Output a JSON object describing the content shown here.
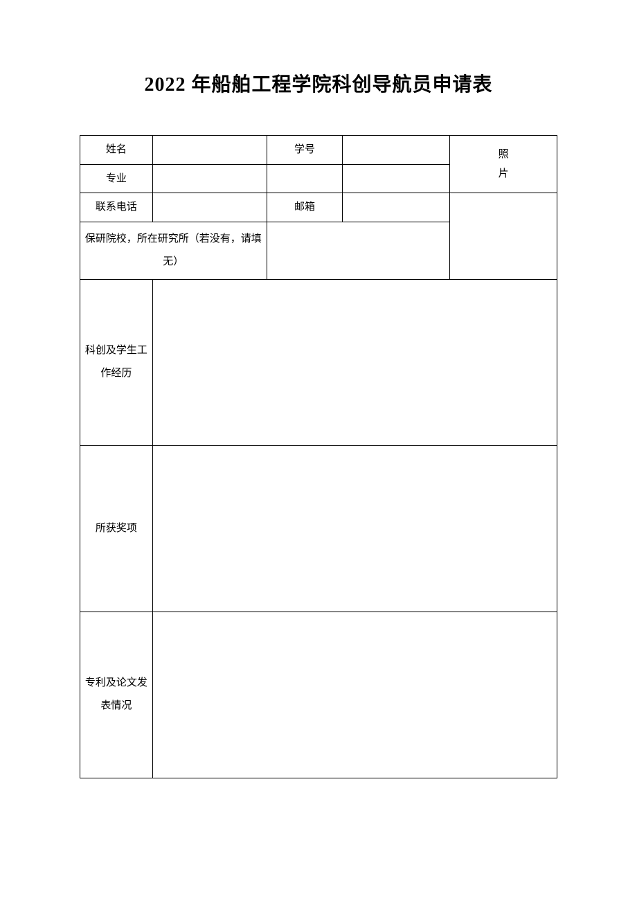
{
  "title": "2022 年船舶工程学院科创导航员申请表",
  "labels": {
    "name": "姓名",
    "student_id": "学号",
    "photo_line1": "照",
    "photo_line2": "片",
    "major": "专业",
    "phone": "联系电话",
    "email": "邮箱",
    "grad_school": "保研院校，所在研究所（若没有，请填无）",
    "experience": "科创及学生工作经历",
    "awards": "所获奖项",
    "patents": "专利及论文发表情况"
  },
  "values": {
    "name": "",
    "student_id": "",
    "major": "",
    "major_extra1": "",
    "major_extra2": "",
    "phone": "",
    "email": "",
    "grad_school": "",
    "experience": "",
    "awards": "",
    "patents": ""
  }
}
